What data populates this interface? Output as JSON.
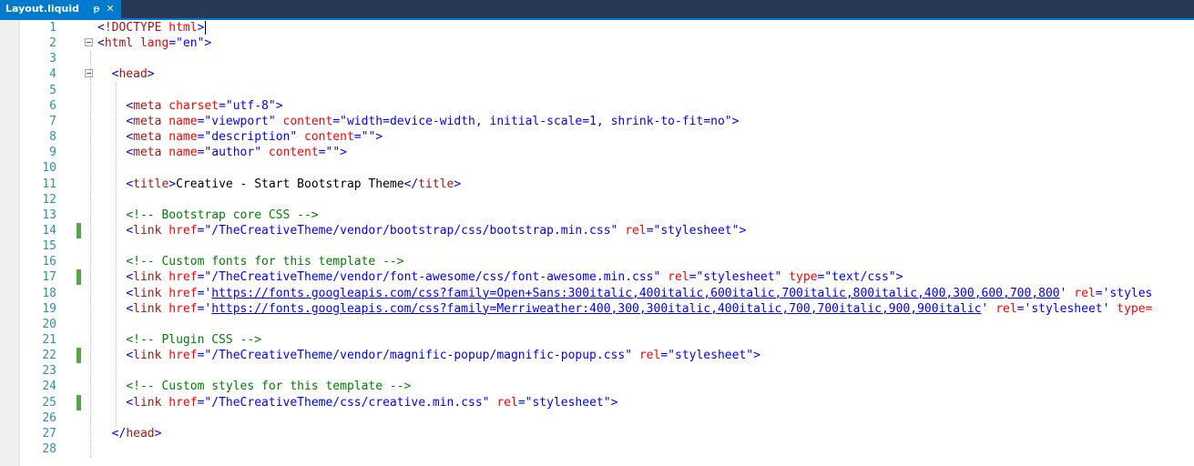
{
  "tab": {
    "title": "Layout.liquid",
    "pin_icon": "pin-icon",
    "close_icon": "close-icon",
    "pin_glyph": "ᵽ",
    "close_glyph": "✕"
  },
  "colors": {
    "line_number": "#2b91af",
    "delimiter": "#0000ff",
    "tag": "#a31515",
    "attribute": "#ff0000",
    "value": "#0000ff",
    "comment": "#008000",
    "change_marker": "#57a64a",
    "tab_active": "#007acc"
  },
  "lines": [
    {
      "n": "1",
      "indent": 0,
      "tokens": [
        [
          "d",
          "<"
        ],
        [
          "g",
          "!DOCTYPE"
        ],
        [
          "t",
          " "
        ],
        [
          "a",
          "html"
        ],
        [
          "d",
          ">"
        ]
      ]
    },
    {
      "n": "2",
      "indent": 0,
      "fold": true,
      "tokens": [
        [
          "d",
          "<"
        ],
        [
          "g",
          "html"
        ],
        [
          "t",
          " "
        ],
        [
          "a",
          "lang"
        ],
        [
          "d",
          "="
        ],
        [
          "v",
          "\"en\""
        ],
        [
          "d",
          ">"
        ]
      ]
    },
    {
      "n": "3",
      "indent": 0,
      "tokens": []
    },
    {
      "n": "4",
      "indent": 2,
      "fold": true,
      "tokens": [
        [
          "d",
          "<"
        ],
        [
          "g",
          "head"
        ],
        [
          "d",
          ">"
        ]
      ]
    },
    {
      "n": "5",
      "indent": 0,
      "tokens": []
    },
    {
      "n": "6",
      "indent": 4,
      "tokens": [
        [
          "d",
          "<"
        ],
        [
          "g",
          "meta"
        ],
        [
          "t",
          " "
        ],
        [
          "a",
          "charset"
        ],
        [
          "d",
          "="
        ],
        [
          "v",
          "\"utf-8\""
        ],
        [
          "d",
          ">"
        ]
      ]
    },
    {
      "n": "7",
      "indent": 4,
      "tokens": [
        [
          "d",
          "<"
        ],
        [
          "g",
          "meta"
        ],
        [
          "t",
          " "
        ],
        [
          "a",
          "name"
        ],
        [
          "d",
          "="
        ],
        [
          "v",
          "\"viewport\""
        ],
        [
          "t",
          " "
        ],
        [
          "a",
          "content"
        ],
        [
          "d",
          "="
        ],
        [
          "v",
          "\"width=device-width, initial-scale=1, shrink-to-fit=no\""
        ],
        [
          "d",
          ">"
        ]
      ]
    },
    {
      "n": "8",
      "indent": 4,
      "tokens": [
        [
          "d",
          "<"
        ],
        [
          "g",
          "meta"
        ],
        [
          "t",
          " "
        ],
        [
          "a",
          "name"
        ],
        [
          "d",
          "="
        ],
        [
          "v",
          "\"description\""
        ],
        [
          "t",
          " "
        ],
        [
          "a",
          "content"
        ],
        [
          "d",
          "="
        ],
        [
          "v",
          "\"\""
        ],
        [
          "d",
          ">"
        ]
      ]
    },
    {
      "n": "9",
      "indent": 4,
      "tokens": [
        [
          "d",
          "<"
        ],
        [
          "g",
          "meta"
        ],
        [
          "t",
          " "
        ],
        [
          "a",
          "name"
        ],
        [
          "d",
          "="
        ],
        [
          "v",
          "\"author\""
        ],
        [
          "t",
          " "
        ],
        [
          "a",
          "content"
        ],
        [
          "d",
          "="
        ],
        [
          "v",
          "\"\""
        ],
        [
          "d",
          ">"
        ]
      ]
    },
    {
      "n": "10",
      "indent": 0,
      "tokens": []
    },
    {
      "n": "11",
      "indent": 4,
      "tokens": [
        [
          "d",
          "<"
        ],
        [
          "g",
          "title"
        ],
        [
          "d",
          ">"
        ],
        [
          "t",
          "Creative - Start Bootstrap Theme"
        ],
        [
          "d",
          "</"
        ],
        [
          "g",
          "title"
        ],
        [
          "d",
          ">"
        ]
      ]
    },
    {
      "n": "12",
      "indent": 0,
      "tokens": []
    },
    {
      "n": "13",
      "indent": 4,
      "tokens": [
        [
          "c",
          "<!-- Bootstrap core CSS -->"
        ]
      ]
    },
    {
      "n": "14",
      "indent": 4,
      "changed": true,
      "tokens": [
        [
          "d",
          "<"
        ],
        [
          "g",
          "link"
        ],
        [
          "t",
          " "
        ],
        [
          "a",
          "href"
        ],
        [
          "d",
          "="
        ],
        [
          "v",
          "\"/TheCreativeTheme/vendor/bootstrap/css/bootstrap.min.css\""
        ],
        [
          "t",
          " "
        ],
        [
          "a",
          "rel"
        ],
        [
          "d",
          "="
        ],
        [
          "v",
          "\"stylesheet\""
        ],
        [
          "d",
          ">"
        ]
      ]
    },
    {
      "n": "15",
      "indent": 0,
      "tokens": []
    },
    {
      "n": "16",
      "indent": 4,
      "tokens": [
        [
          "c",
          "<!-- Custom fonts for this template -->"
        ]
      ]
    },
    {
      "n": "17",
      "indent": 4,
      "changed": true,
      "tokens": [
        [
          "d",
          "<"
        ],
        [
          "g",
          "link"
        ],
        [
          "t",
          " "
        ],
        [
          "a",
          "href"
        ],
        [
          "d",
          "="
        ],
        [
          "v",
          "\"/TheCreativeTheme/vendor/font-awesome/css/font-awesome.min.css\""
        ],
        [
          "t",
          " "
        ],
        [
          "a",
          "rel"
        ],
        [
          "d",
          "="
        ],
        [
          "v",
          "\"stylesheet\""
        ],
        [
          "t",
          " "
        ],
        [
          "a",
          "type"
        ],
        [
          "d",
          "="
        ],
        [
          "v",
          "\"text/css\""
        ],
        [
          "d",
          ">"
        ]
      ]
    },
    {
      "n": "18",
      "indent": 4,
      "tokens": [
        [
          "d",
          "<"
        ],
        [
          "g",
          "link"
        ],
        [
          "t",
          " "
        ],
        [
          "a",
          "href"
        ],
        [
          "d",
          "="
        ],
        [
          "v",
          "'"
        ],
        [
          "u",
          "https://fonts.googleapis.com/css?family=Open+Sans:300italic,400italic,600italic,700italic,800italic,400,300,600,700,800"
        ],
        [
          "v",
          "'"
        ],
        [
          "t",
          " "
        ],
        [
          "a",
          "rel"
        ],
        [
          "d",
          "="
        ],
        [
          "v",
          "'styles"
        ]
      ]
    },
    {
      "n": "19",
      "indent": 4,
      "tokens": [
        [
          "d",
          "<"
        ],
        [
          "g",
          "link"
        ],
        [
          "t",
          " "
        ],
        [
          "a",
          "href"
        ],
        [
          "d",
          "="
        ],
        [
          "v",
          "'"
        ],
        [
          "u",
          "https://fonts.googleapis.com/css?family=Merriweather:400,300,300italic,400italic,700,700italic,900,900italic"
        ],
        [
          "v",
          "'"
        ],
        [
          "t",
          " "
        ],
        [
          "a",
          "rel"
        ],
        [
          "d",
          "="
        ],
        [
          "v",
          "'stylesheet'"
        ],
        [
          "t",
          " "
        ],
        [
          "a",
          "type="
        ]
      ]
    },
    {
      "n": "20",
      "indent": 0,
      "tokens": []
    },
    {
      "n": "21",
      "indent": 4,
      "tokens": [
        [
          "c",
          "<!-- Plugin CSS -->"
        ]
      ]
    },
    {
      "n": "22",
      "indent": 4,
      "changed": true,
      "tokens": [
        [
          "d",
          "<"
        ],
        [
          "g",
          "link"
        ],
        [
          "t",
          " "
        ],
        [
          "a",
          "href"
        ],
        [
          "d",
          "="
        ],
        [
          "v",
          "\"/TheCreativeTheme/vendor/magnific-popup/magnific-popup.css\""
        ],
        [
          "t",
          " "
        ],
        [
          "a",
          "rel"
        ],
        [
          "d",
          "="
        ],
        [
          "v",
          "\"stylesheet\""
        ],
        [
          "d",
          ">"
        ]
      ]
    },
    {
      "n": "23",
      "indent": 0,
      "tokens": []
    },
    {
      "n": "24",
      "indent": 4,
      "tokens": [
        [
          "c",
          "<!-- Custom styles for this template -->"
        ]
      ]
    },
    {
      "n": "25",
      "indent": 4,
      "changed": true,
      "tokens": [
        [
          "d",
          "<"
        ],
        [
          "g",
          "link"
        ],
        [
          "t",
          " "
        ],
        [
          "a",
          "href"
        ],
        [
          "d",
          "="
        ],
        [
          "v",
          "\"/TheCreativeTheme/css/creative.min.css\""
        ],
        [
          "t",
          " "
        ],
        [
          "a",
          "rel"
        ],
        [
          "d",
          "="
        ],
        [
          "v",
          "\"stylesheet\""
        ],
        [
          "d",
          ">"
        ]
      ]
    },
    {
      "n": "26",
      "indent": 0,
      "tokens": []
    },
    {
      "n": "27",
      "indent": 2,
      "tokens": [
        [
          "d",
          "</"
        ],
        [
          "g",
          "head"
        ],
        [
          "d",
          ">"
        ]
      ]
    },
    {
      "n": "28",
      "indent": 0,
      "tokens": []
    }
  ]
}
